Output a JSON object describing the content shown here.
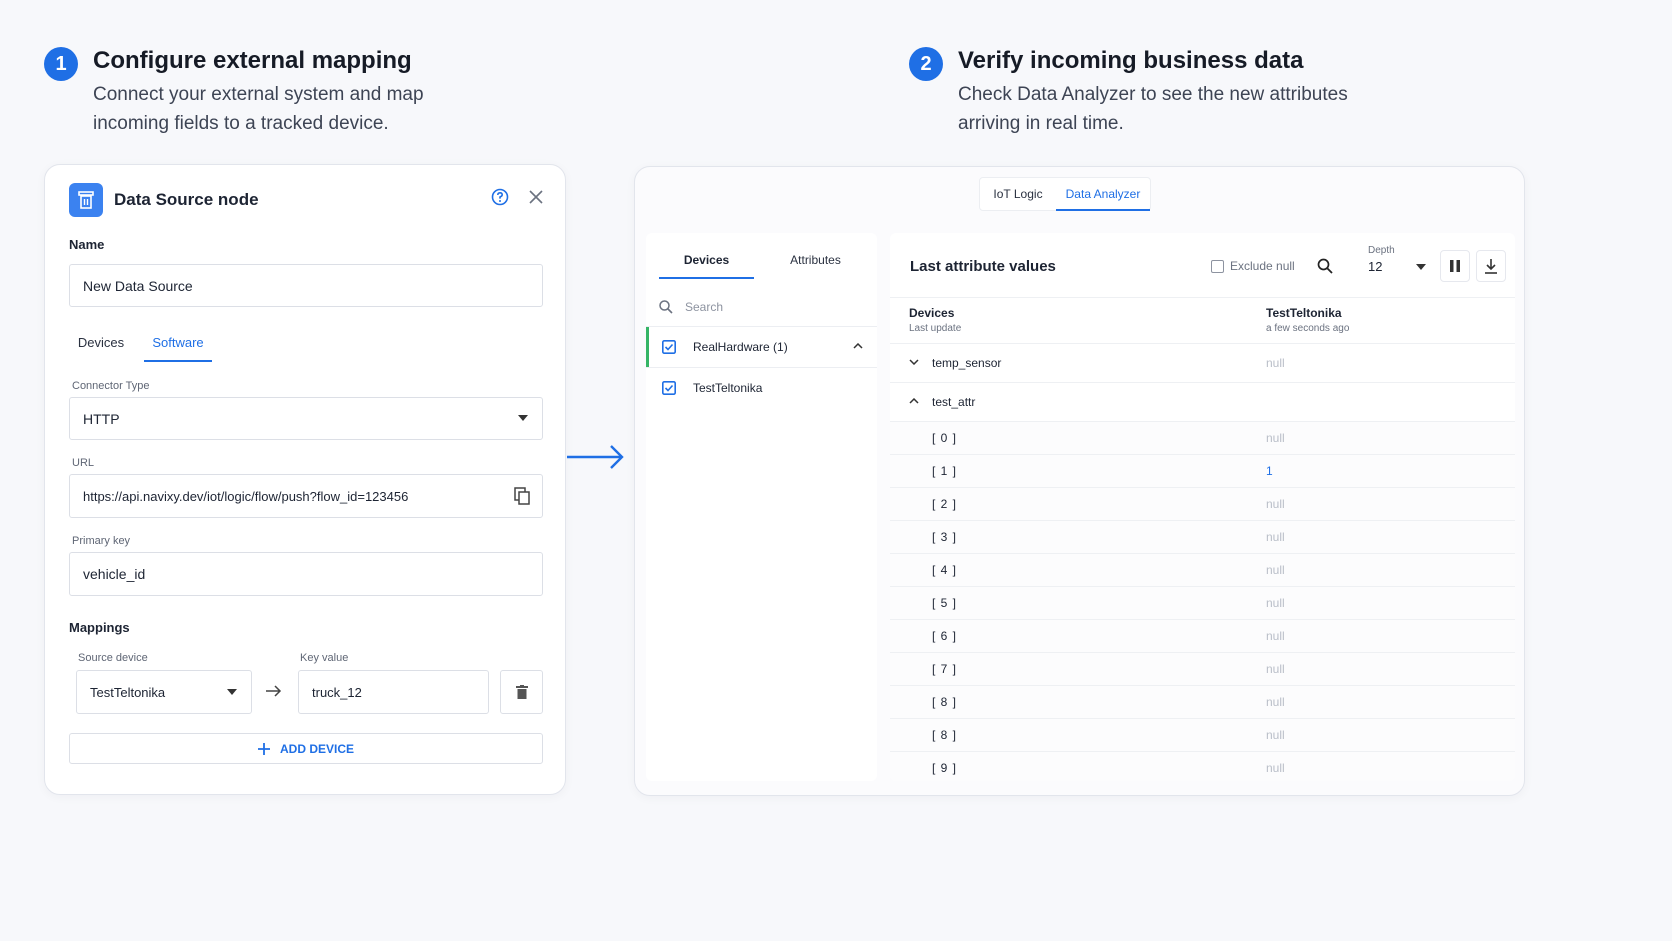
{
  "steps": [
    {
      "number": "1",
      "title": "Configure external mapping",
      "desc_line1": "Connect your external system and map",
      "desc_line2": "incoming fields to a tracked device."
    },
    {
      "number": "2",
      "title": "Verify incoming business data",
      "desc_line1": "Check Data Analyzer to see the new attributes",
      "desc_line2": "arriving in real time."
    }
  ],
  "node_panel": {
    "title": "Data Source node",
    "node_icon": "trash-bin-icon",
    "name_label": "Name",
    "name_value": "New Data Source",
    "tabs": [
      "Devices",
      "Software"
    ],
    "active_tab": "Software",
    "connector_label": "Connector Type",
    "connector_value": "HTTP",
    "url_label": "URL",
    "url_value": "https://api.navixy.dev/iot/logic/flow/push?flow_id=123456",
    "primary_key_label": "Primary key",
    "primary_key_value": "vehicle_id",
    "mappings_label": "Mappings",
    "source_device_label": "Source device",
    "source_device_value": "TestTeltonika",
    "key_value_label": "Key value",
    "key_value_value": "truck_12",
    "add_device_label": "ADD DEVICE"
  },
  "analyzer": {
    "top_tabs": [
      "IoT Logic",
      "Data Analyzer"
    ],
    "active_top_tab": "Data Analyzer",
    "side_tabs": [
      "Devices",
      "Attributes"
    ],
    "search_placeholder": "Search",
    "devices": [
      {
        "label": "RealHardware (1)",
        "checked": true,
        "expanded": true
      },
      {
        "label": "TestTeltonika",
        "checked": true
      }
    ],
    "title": "Last attribute values",
    "exclude_null_label": "Exclude null",
    "depth_label": "Depth",
    "depth_value": "12",
    "col_devices": "Devices",
    "col_last_update": "Last update",
    "col_device_name": "TestTeltonika",
    "col_device_update": "a few seconds ago",
    "rows": [
      {
        "name": "temp_sensor",
        "value": "null",
        "type": "group-collapsed"
      },
      {
        "name": "test_attr",
        "value": "",
        "type": "group-expanded"
      },
      {
        "name": "[ 0 ]",
        "value": "null"
      },
      {
        "name": "[ 1 ]",
        "value": "1"
      },
      {
        "name": "[ 2 ]",
        "value": "null"
      },
      {
        "name": "[ 3 ]",
        "value": "null"
      },
      {
        "name": "[ 4 ]",
        "value": "null"
      },
      {
        "name": "[ 5 ]",
        "value": "null"
      },
      {
        "name": "[ 6 ]",
        "value": "null"
      },
      {
        "name": "[ 7 ]",
        "value": "null"
      },
      {
        "name": "[ 8 ]",
        "value": "null"
      },
      {
        "name": "[ 8 ]",
        "value": "null"
      },
      {
        "name": "[ 9 ]",
        "value": "null"
      }
    ]
  },
  "colors": {
    "accent": "#1f6fe5",
    "highlight_bar": "#35b566",
    "value_blue": "#1f6fe5"
  }
}
